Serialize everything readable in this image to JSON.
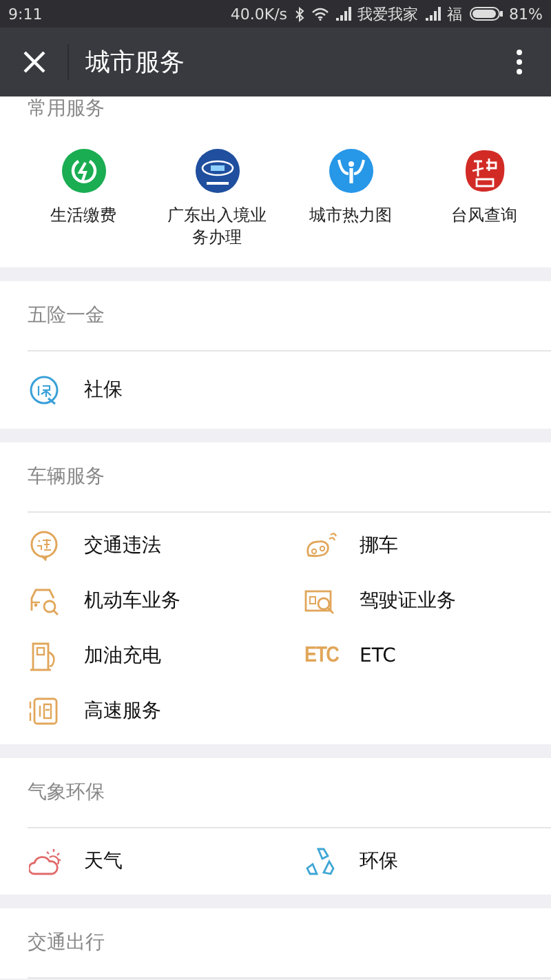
{
  "status_bar": {
    "time": "9:11",
    "speed": "40.0K/s",
    "carrier_1": "我爱我家",
    "carrier_2": "福",
    "battery": "81%"
  },
  "header": {
    "title": "城市服务"
  },
  "sections": [
    {
      "kind": "grid",
      "title": "常用服务",
      "items": [
        {
          "label": "生活缴费"
        },
        {
          "label": "广东出入境业务办理"
        },
        {
          "label": "城市热力图"
        },
        {
          "label": "台风查询"
        }
      ]
    },
    {
      "kind": "list",
      "title": "五险一金",
      "items": [
        {
          "label": "社保"
        }
      ]
    },
    {
      "kind": "list",
      "title": "车辆服务",
      "items": [
        {
          "label": "交通违法"
        },
        {
          "label": "挪车"
        },
        {
          "label": "机动车业务"
        },
        {
          "label": "驾驶证业务"
        },
        {
          "label": "加油充电"
        },
        {
          "label": "ETC",
          "icon_text": "ETC"
        },
        {
          "label": "高速服务"
        }
      ]
    },
    {
      "kind": "list",
      "title": "气象环保",
      "items": [
        {
          "label": "天气"
        },
        {
          "label": "环保"
        }
      ]
    },
    {
      "kind": "list",
      "title": "交通出行"
    }
  ]
}
